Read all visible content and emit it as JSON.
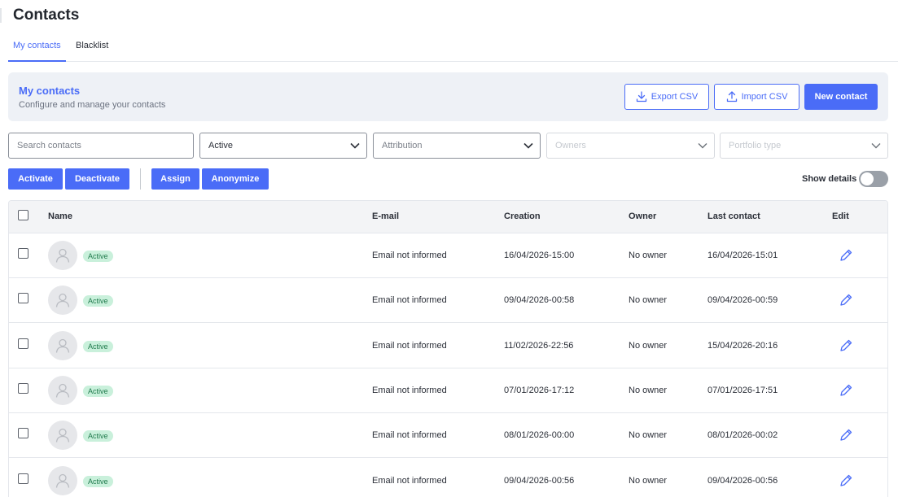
{
  "page": {
    "title": "Contacts"
  },
  "tabs": [
    {
      "label": "My contacts",
      "active": true
    },
    {
      "label": "Blacklist",
      "active": false
    }
  ],
  "header": {
    "title": "My contacts",
    "subtitle": "Configure and manage your contacts",
    "export_label": "Export CSV",
    "import_label": "Import CSV",
    "new_label": "New contact",
    "export_icon": "download-icon",
    "import_icon": "upload-icon"
  },
  "filters": {
    "search": {
      "placeholder": "Search contacts",
      "value": ""
    },
    "status": {
      "value": "Active"
    },
    "attribution": {
      "placeholder": "Attribution"
    },
    "owners": {
      "placeholder": "Owners",
      "disabled": true
    },
    "portfolio": {
      "placeholder": "Portfolio type",
      "disabled": true
    }
  },
  "actions": {
    "activate": "Activate",
    "deactivate": "Deactivate",
    "assign": "Assign",
    "anonymize": "Anonymize",
    "show_details": "Show details",
    "show_details_on": false
  },
  "table": {
    "columns": {
      "name": "Name",
      "email": "E-mail",
      "creation": "Creation",
      "owner": "Owner",
      "last_contact": "Last contact",
      "edit": "Edit"
    },
    "rows": [
      {
        "status": "Active",
        "email": "Email not informed",
        "creation": "16/04/2026-15:00",
        "owner": "No owner",
        "last_contact": "16/04/2026-15:01"
      },
      {
        "status": "Active",
        "email": "Email not informed",
        "creation": "09/04/2026-00:58",
        "owner": "No owner",
        "last_contact": "09/04/2026-00:59"
      },
      {
        "status": "Active",
        "email": "Email not informed",
        "creation": "11/02/2026-22:56",
        "owner": "No owner",
        "last_contact": "15/04/2026-20:16"
      },
      {
        "status": "Active",
        "email": "Email not informed",
        "creation": "07/01/2026-17:12",
        "owner": "No owner",
        "last_contact": "07/01/2026-17:51"
      },
      {
        "status": "Active",
        "email": "Email not informed",
        "creation": "08/01/2026-00:00",
        "owner": "No owner",
        "last_contact": "08/01/2026-00:02"
      },
      {
        "status": "Active",
        "email": "Email not informed",
        "creation": "09/04/2026-00:56",
        "owner": "No owner",
        "last_contact": "09/04/2026-00:56"
      }
    ]
  },
  "colors": {
    "accent": "#4a6cf7",
    "active_badge_bg": "#c9f0db",
    "active_badge_text": "#1f7a4c",
    "header_bg": "#eef1f6"
  }
}
